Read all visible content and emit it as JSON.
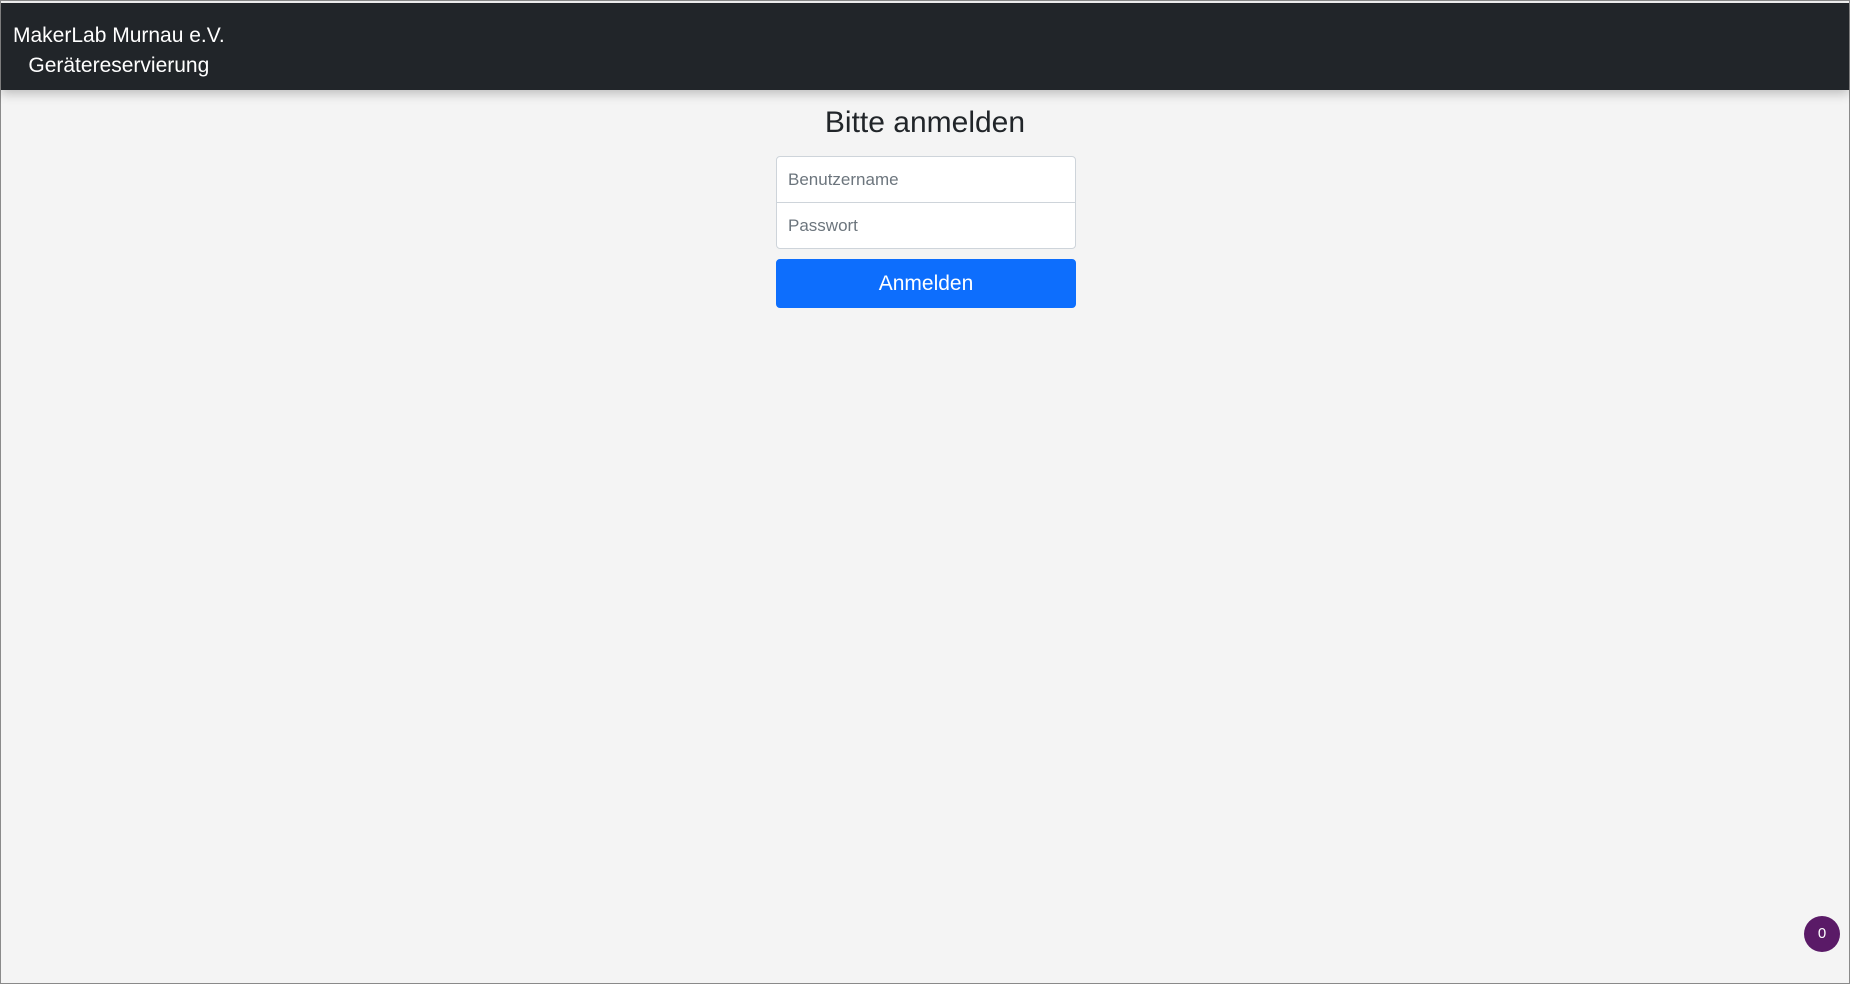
{
  "header": {
    "brand_line1": "MakerLab Murnau e.V.",
    "brand_line2": "Gerätereservierung",
    "background": "#212529"
  },
  "login": {
    "title": "Bitte anmelden",
    "username_placeholder": "Benutzername",
    "username_value": "",
    "password_placeholder": "Passwort",
    "password_value": "",
    "submit_label": "Anmelden",
    "submit_color": "#0d6efd"
  },
  "floating_badge": {
    "count": "0",
    "color": "#5a1a67"
  }
}
